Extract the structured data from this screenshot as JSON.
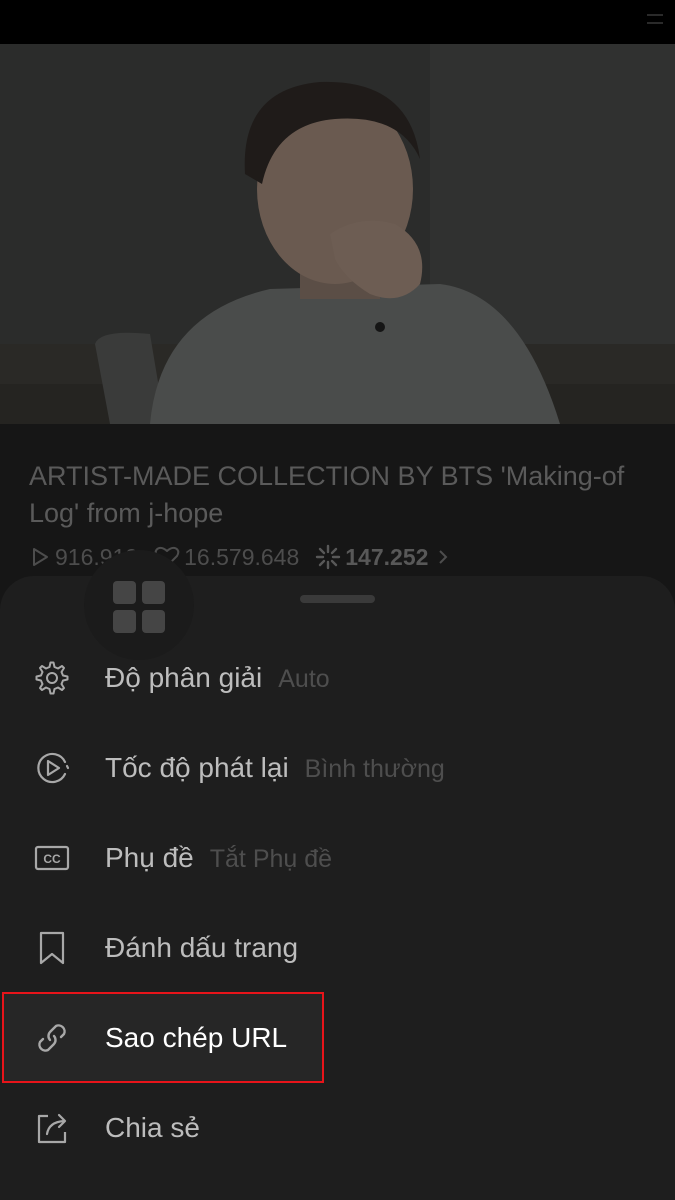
{
  "video": {
    "title": "ARTIST-MADE COLLECTION BY BTS 'Making-of Log' from j-hope",
    "stats": {
      "plays": "916.919",
      "likes": "16.579.648",
      "sparkles": "147.252"
    }
  },
  "sheet": {
    "items": [
      {
        "label": "Độ phân giải",
        "value": "Auto",
        "icon": "gear-icon"
      },
      {
        "label": "Tốc độ phát lại",
        "value": "Bình thường",
        "icon": "playback-speed-icon"
      },
      {
        "label": "Phụ đề",
        "value": "Tắt Phụ đề",
        "icon": "cc-icon"
      },
      {
        "label": "Đánh dấu trang",
        "value": "",
        "icon": "bookmark-icon"
      },
      {
        "label": "Sao chép URL",
        "value": "",
        "icon": "link-icon",
        "highlighted": true
      },
      {
        "label": "Chia sẻ",
        "value": "",
        "icon": "share-icon"
      }
    ]
  },
  "colors": {
    "highlight_border": "#e8141a",
    "sheet_background": "#1e1e1e"
  }
}
